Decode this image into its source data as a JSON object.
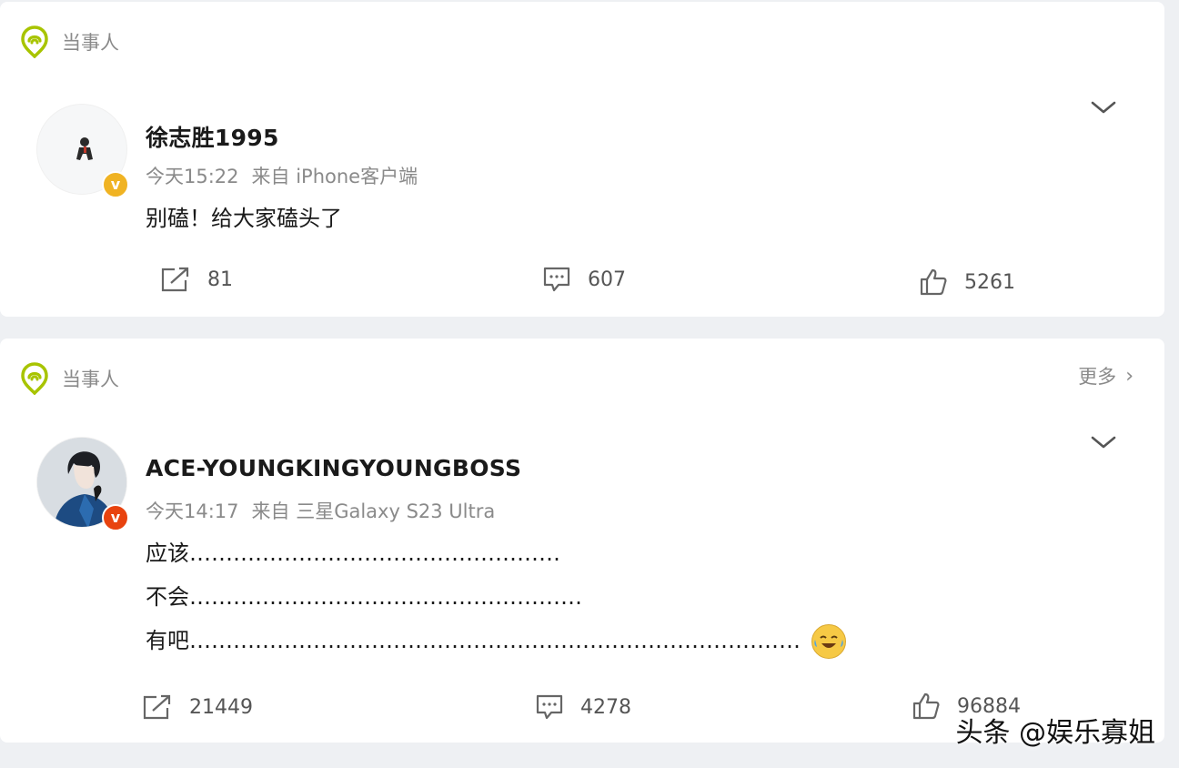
{
  "posts": [
    {
      "tag_label": "当事人",
      "username": "徐志胜1995",
      "time": "今天15:22",
      "source": "来自 iPhone客户端",
      "badge_letter": "v",
      "badge_color": "#f0b323",
      "content_lines": [
        "别磕！给大家磕头了"
      ],
      "reposts": "81",
      "comments": "607",
      "likes": "5261"
    },
    {
      "tag_label": "当事人",
      "more_label": "更多",
      "username": "ACE-YOUNGKINGYOUNGBOSS",
      "time": "今天14:17",
      "source": "来自 三星Galaxy S23 Ultra",
      "badge_letter": "v",
      "badge_color": "#e8430f",
      "content_lines": [
        "应该……………………………………………",
        "不会………………………………………………",
        "有吧…………………………………………………………………………"
      ],
      "reposts": "21449",
      "comments": "4278",
      "likes": "96884"
    }
  ],
  "icons": {
    "tag": "location-pin-icon",
    "expand": "chevron-down-icon",
    "repost": "repost-icon",
    "comment": "comment-icon",
    "like": "thumbs-up-icon",
    "emoji": "laughing-crying-emoji-icon"
  },
  "colors": {
    "tag_green": "#a8c400",
    "secondary_text": "#8a8a8a"
  },
  "watermark": "头条 @娱乐寡姐"
}
